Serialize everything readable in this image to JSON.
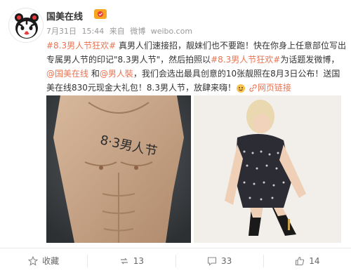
{
  "account": {
    "name": "国美在线"
  },
  "meta": {
    "date": "7月31日",
    "time": "15:44",
    "source_prefix": "来自",
    "source": "微博",
    "source_domain": "weibo.com"
  },
  "post": {
    "topic_1": "#8.3男人节狂欢#",
    "text_1": " 真男人们速接招，靓妹们也不要跑！快在你身上任意部位写出专属男人节的印记\"8.3男人节\"，然后拍照以",
    "topic_2": "#8.3男人节狂欢#",
    "text_2": "为话题发微博，",
    "mention_1": "@国美在线",
    "text_3": " 和",
    "mention_2": "@男人裝",
    "text_4": "，我们会选出最具创意的10张靓照在8月3日公布！送国美在线830元现金大礼包！8.3男人节，放肆来嗨！",
    "link_label": "网页链接"
  },
  "images": {
    "left_caption": "8·3男人节"
  },
  "actions": {
    "favorite": "收藏",
    "repost": "13",
    "comment": "33",
    "like": "14"
  },
  "colors": {
    "accent": "#eb7350",
    "muted": "#999999"
  }
}
